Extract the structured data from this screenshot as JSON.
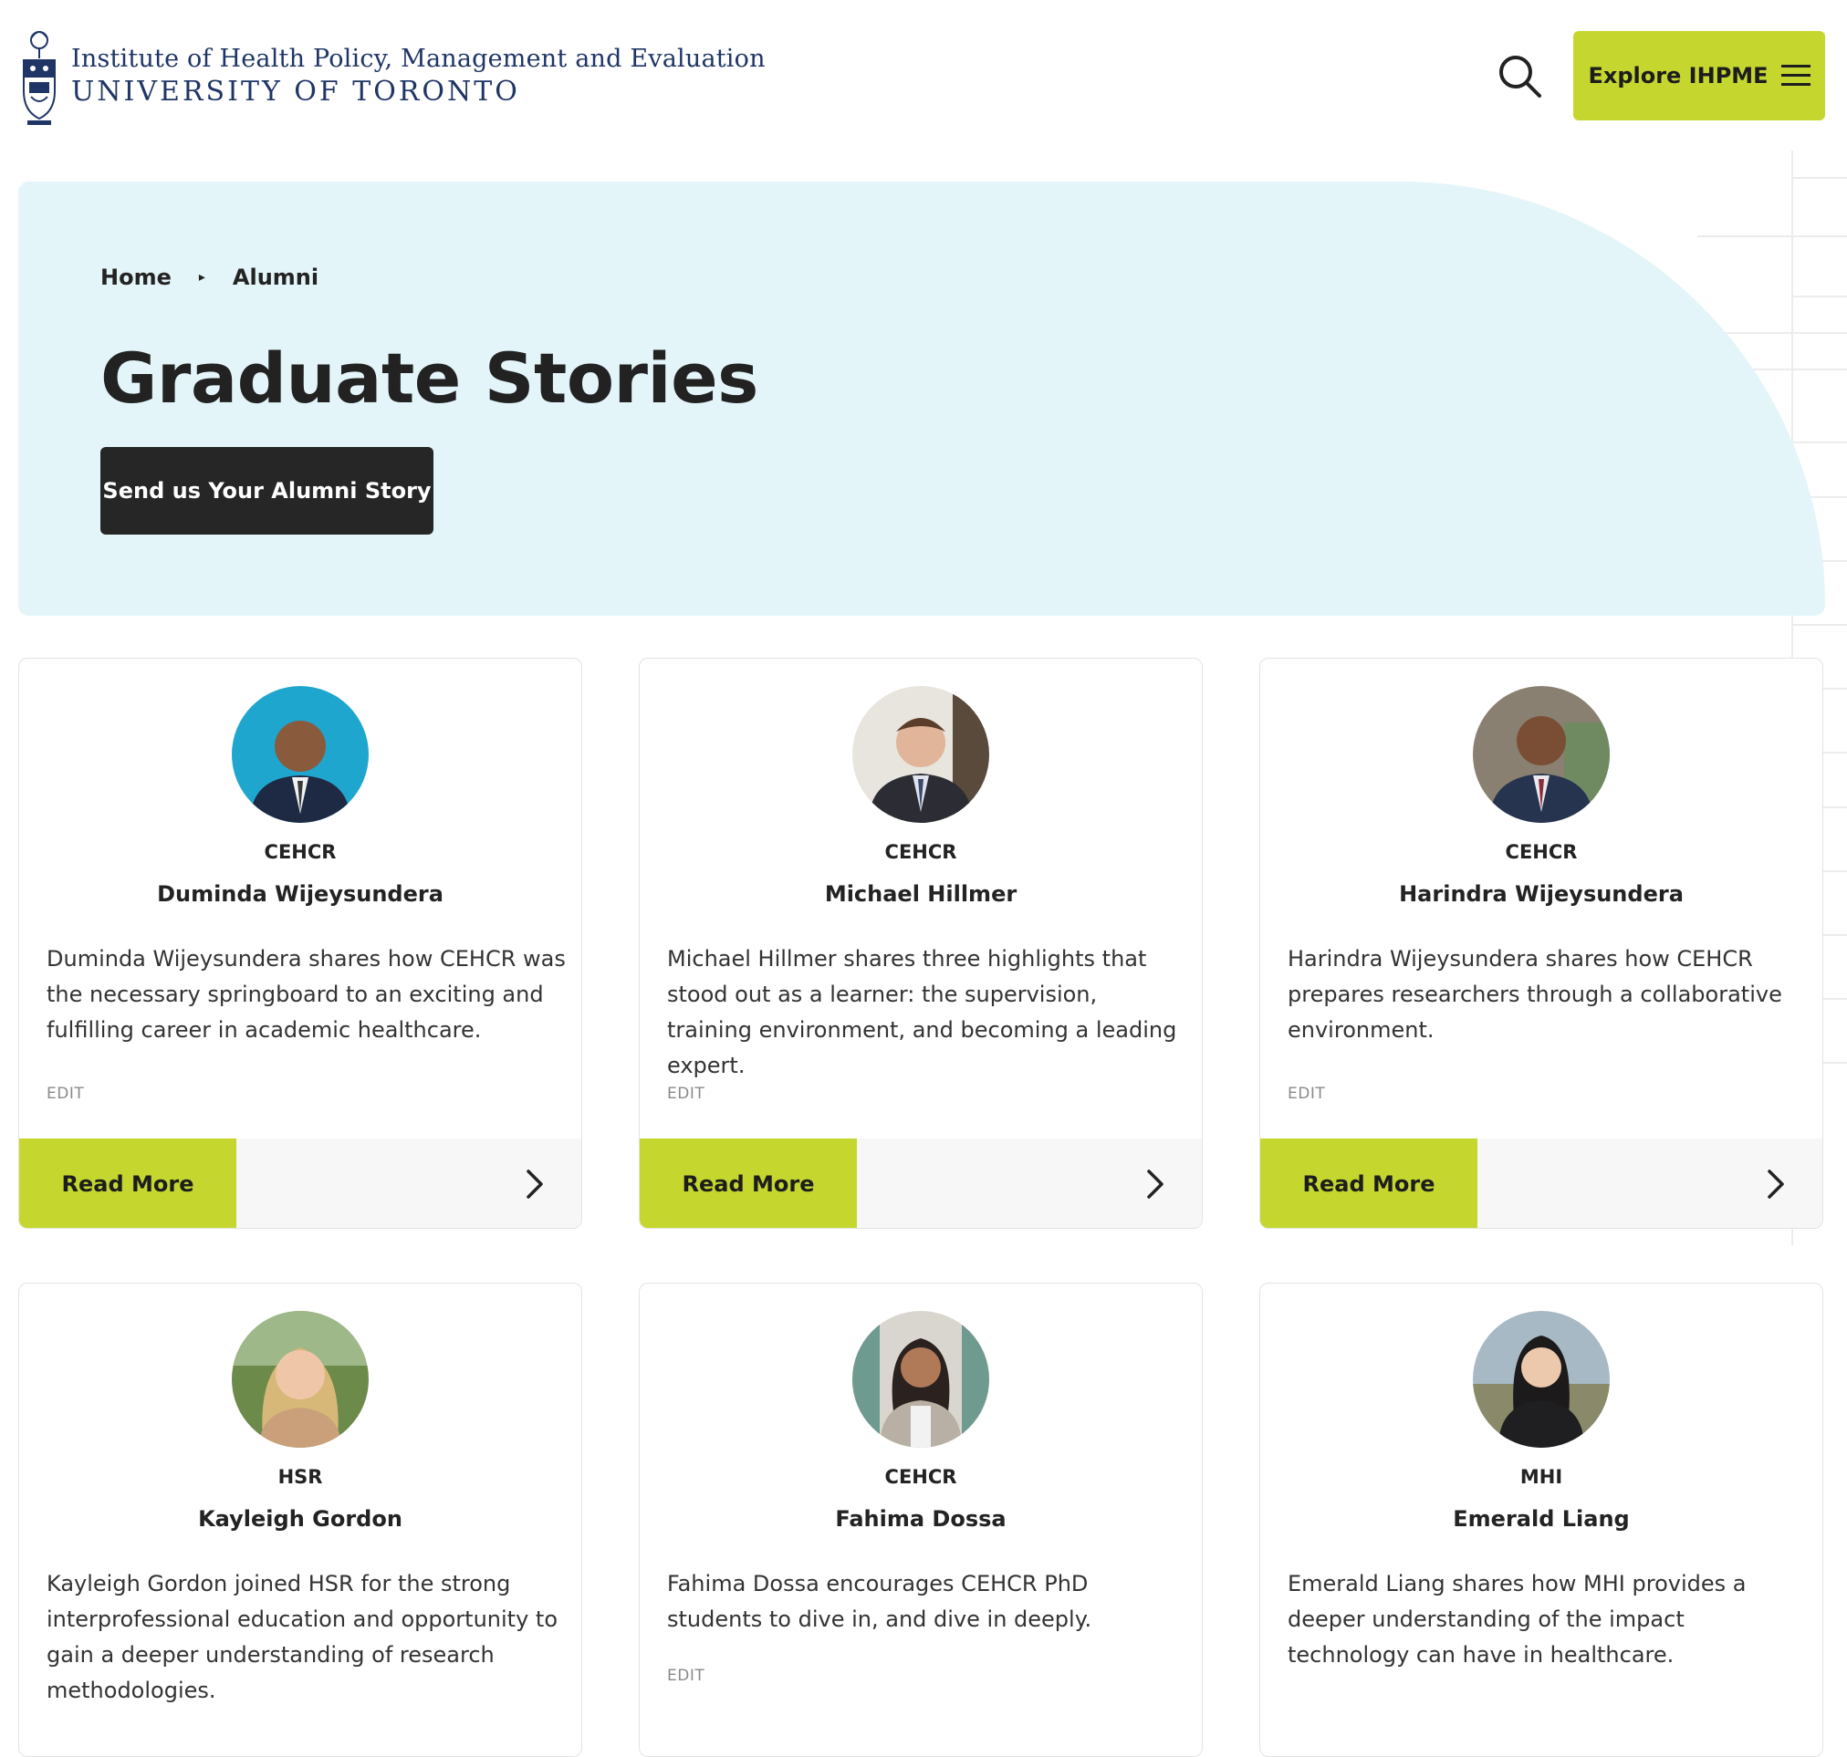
{
  "header": {
    "logo_line1": "Institute of Health Policy, Management and Evaluation",
    "logo_line2": "UNIVERSITY OF TORONTO",
    "explore_label": "Explore IHPME",
    "accent_color": "#c5d72e",
    "search_icon": "search-icon",
    "menu_icon": "hamburger-icon"
  },
  "breadcrumb": {
    "home": "Home",
    "separator": "▸",
    "current": "Alumni"
  },
  "hero": {
    "title": "Graduate Stories",
    "cta_label": "Send us Your Alumni Story",
    "background_color": "#e4f5fa"
  },
  "cards": [
    {
      "program": "CEHCR",
      "name": "Duminda Wijeysundera",
      "description": "Duminda Wijeysundera shares how CEHCR was the necessary springboard to an exciting and fulfilling career in academic healthcare.",
      "edit_label": "EDIT",
      "read_more_label": "Read More"
    },
    {
      "program": "CEHCR",
      "name": "Michael Hillmer",
      "description": "Michael Hillmer shares three highlights that stood out as a learner: the supervision, training environment, and becoming a leading expert.",
      "edit_label": "EDIT",
      "read_more_label": "Read More"
    },
    {
      "program": "CEHCR",
      "name": "Harindra Wijeysundera",
      "description": "Harindra Wijeysundera shares how CEHCR prepares researchers through a collaborative environment.",
      "edit_label": "EDIT",
      "read_more_label": "Read More"
    },
    {
      "program": "HSR",
      "name": "Kayleigh Gordon",
      "description": "Kayleigh Gordon joined HSR for the strong interprofessional education and opportunity to gain a deeper understanding of research methodologies."
    },
    {
      "program": "CEHCR",
      "name": "Fahima Dossa",
      "description": "Fahima Dossa encourages CEHCR PhD students to dive in, and dive in deeply.",
      "edit_label": "EDIT"
    },
    {
      "program": "MHI",
      "name": "Emerald Liang",
      "description": "Emerald Liang shares how MHI provides a deeper understanding of the impact technology can have in healthcare."
    }
  ]
}
